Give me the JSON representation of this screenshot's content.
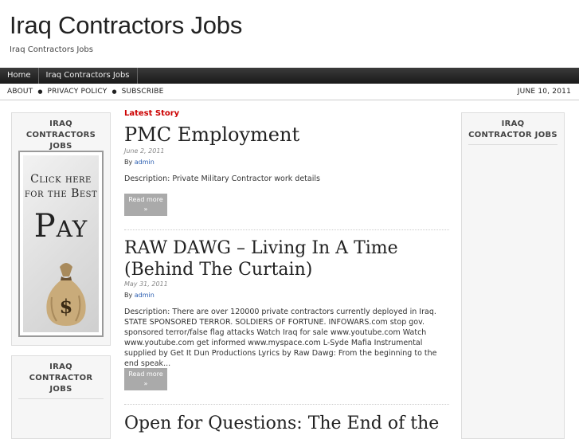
{
  "site": {
    "title": "Iraq Contractors Jobs",
    "description": "Iraq Contractors Jobs"
  },
  "nav": {
    "items": [
      "Home",
      "Iraq Contractors Jobs"
    ]
  },
  "secnav": {
    "items": [
      "ABOUT",
      "PRIVACY POLICY",
      "SUBSCRIBE"
    ],
    "separator": "●",
    "date": "JUNE 10, 2011"
  },
  "sidebar_left": {
    "widget1_title": "IRAQ CONTRACTORS JOBS",
    "widget2_title": "IRAQ CONTRACTOR JOBS",
    "ad": {
      "line1": "Click here",
      "line2": "for the Best",
      "line3": "Pay",
      "symbol": "$"
    }
  },
  "sidebar_right": {
    "widget_title": "IRAQ CONTRACTOR JOBS"
  },
  "main": {
    "latest_label": "Latest Story",
    "read_more_label": "Read more",
    "read_more_arrow": "»",
    "by_label": "By",
    "posts": [
      {
        "title": "PMC Employment",
        "date": "June 2, 2011",
        "author": "admin",
        "description": "Description: Private Military Contractor work details"
      },
      {
        "title": "RAW DAWG – Living In A Time (Behind The Curtain)",
        "date": "May 31, 2011",
        "author": "admin",
        "description": "Description: There are over 120000 private contractors currently deployed in Iraq. STATE SPONSORED TERROR. SOLDIERS OF FORTUNE. INFOWARS.com stop gov. sponsored terror/false flag attacks Watch Iraq for sale www.youtube.com Watch www.youtube.com get informed www.myspace.com L-Syde Mafia Instrumental supplied by Get It Dun Productions Lyrics by Raw Dawg: From the beginning to the end speak..."
      },
      {
        "title": "Open for Questions: The End of the"
      }
    ]
  }
}
